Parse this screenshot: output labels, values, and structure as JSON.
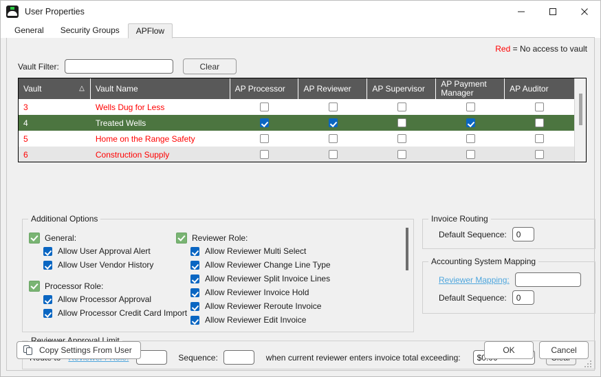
{
  "window": {
    "title": "User Properties",
    "icon": "app-logo-icon",
    "controls": [
      {
        "name": "minimize-button",
        "glyph": "minimize-icon"
      },
      {
        "name": "maximize-button",
        "glyph": "maximize-icon"
      },
      {
        "name": "close-button",
        "glyph": "close-icon"
      }
    ]
  },
  "tabs": [
    {
      "label": "General",
      "active": false
    },
    {
      "label": "Security Groups",
      "active": false
    },
    {
      "label": "APFlow",
      "active": true
    }
  ],
  "legend": {
    "red_word": "Red",
    "text": "= No access to vault"
  },
  "vault_filter": {
    "label": "Vault Filter:",
    "value": "",
    "placeholder": "",
    "clear_label": "Clear"
  },
  "grid": {
    "columns": [
      {
        "key": "vault",
        "label": "Vault",
        "sort": "△"
      },
      {
        "key": "vault_name",
        "label": "Vault Name"
      },
      {
        "key": "ap_processor",
        "label": "AP Processor"
      },
      {
        "key": "ap_reviewer",
        "label": "AP Reviewer"
      },
      {
        "key": "ap_supervisor",
        "label": "AP Supervisor"
      },
      {
        "key": "ap_payment_manager",
        "label": "AP Payment Manager"
      },
      {
        "key": "ap_auditor",
        "label": "AP Auditor"
      }
    ],
    "rows": [
      {
        "vault": "3",
        "vault_name": "Wells Dug for Less",
        "selected": false,
        "alt": false,
        "ap_processor": false,
        "ap_reviewer": false,
        "ap_supervisor": false,
        "ap_payment_manager": false,
        "ap_auditor": false
      },
      {
        "vault": "4",
        "vault_name": "Treated Wells",
        "selected": true,
        "alt": false,
        "ap_processor": true,
        "ap_reviewer": true,
        "ap_supervisor": false,
        "ap_payment_manager": true,
        "ap_auditor": false
      },
      {
        "vault": "5",
        "vault_name": "Home on the Range Safety",
        "selected": false,
        "alt": false,
        "ap_processor": false,
        "ap_reviewer": false,
        "ap_supervisor": false,
        "ap_payment_manager": false,
        "ap_auditor": false
      },
      {
        "vault": "6",
        "vault_name": "Construction Supply",
        "selected": false,
        "alt": true,
        "ap_processor": false,
        "ap_reviewer": false,
        "ap_supervisor": false,
        "ap_payment_manager": false,
        "ap_auditor": false
      }
    ]
  },
  "additional_options": {
    "title": "Additional Options",
    "groups": [
      {
        "header": "General:",
        "checked": true,
        "items": [
          {
            "label": "Allow User Approval Alert",
            "checked": true
          },
          {
            "label": "Allow User Vendor History",
            "checked": true
          }
        ]
      },
      {
        "header": "Processor Role:",
        "checked": true,
        "items": [
          {
            "label": "Allow Processor Approval",
            "checked": true
          },
          {
            "label": "Allow Processor Credit Card Import",
            "checked": true
          }
        ]
      },
      {
        "header": "Reviewer Role:",
        "checked": true,
        "items": [
          {
            "label": "Allow Reviewer Multi Select",
            "checked": true
          },
          {
            "label": "Allow Reviewer Change Line Type",
            "checked": true
          },
          {
            "label": "Allow Reviewer Split Invoice Lines",
            "checked": true
          },
          {
            "label": "Allow Reviewer Invoice Hold",
            "checked": true
          },
          {
            "label": "Allow Reviewer Reroute Invoice",
            "checked": true
          },
          {
            "label": "Allow Reviewer Edit Invoice",
            "checked": true
          }
        ]
      }
    ]
  },
  "invoice_routing": {
    "title": "Invoice Routing",
    "default_sequence_label": "Default Sequence:",
    "default_sequence_value": "0"
  },
  "accounting_mapping": {
    "title": "Accounting System Mapping",
    "reviewer_mapping_label": "Reviewer Mapping:",
    "reviewer_mapping_value": "",
    "default_sequence_label": "Default Sequence:",
    "default_sequence_value": "0"
  },
  "reviewer_approval": {
    "title": "Reviewer Approval Limit",
    "route_to_label": "Route to",
    "reviewer_role_link": "Reviewer / Role:",
    "reviewer_role_value": "",
    "sequence_label": "Sequence:",
    "sequence_value": "",
    "condition_text": "when current reviewer enters invoice total exceeding:",
    "amount_value": "$0.00",
    "clear_label": "Clear"
  },
  "footer": {
    "copy_settings_label": "Copy Settings From User",
    "copy_icon": "copy-icon",
    "ok_label": "OK",
    "cancel_label": "Cancel"
  },
  "colors": {
    "selected_row": "#4c7540",
    "no_access_text": "#ff0000",
    "header_bg": "#595959",
    "checkbox_blue": "#0a66c2",
    "checkbox_green": "#79b473",
    "link": "#4ea6dd"
  }
}
